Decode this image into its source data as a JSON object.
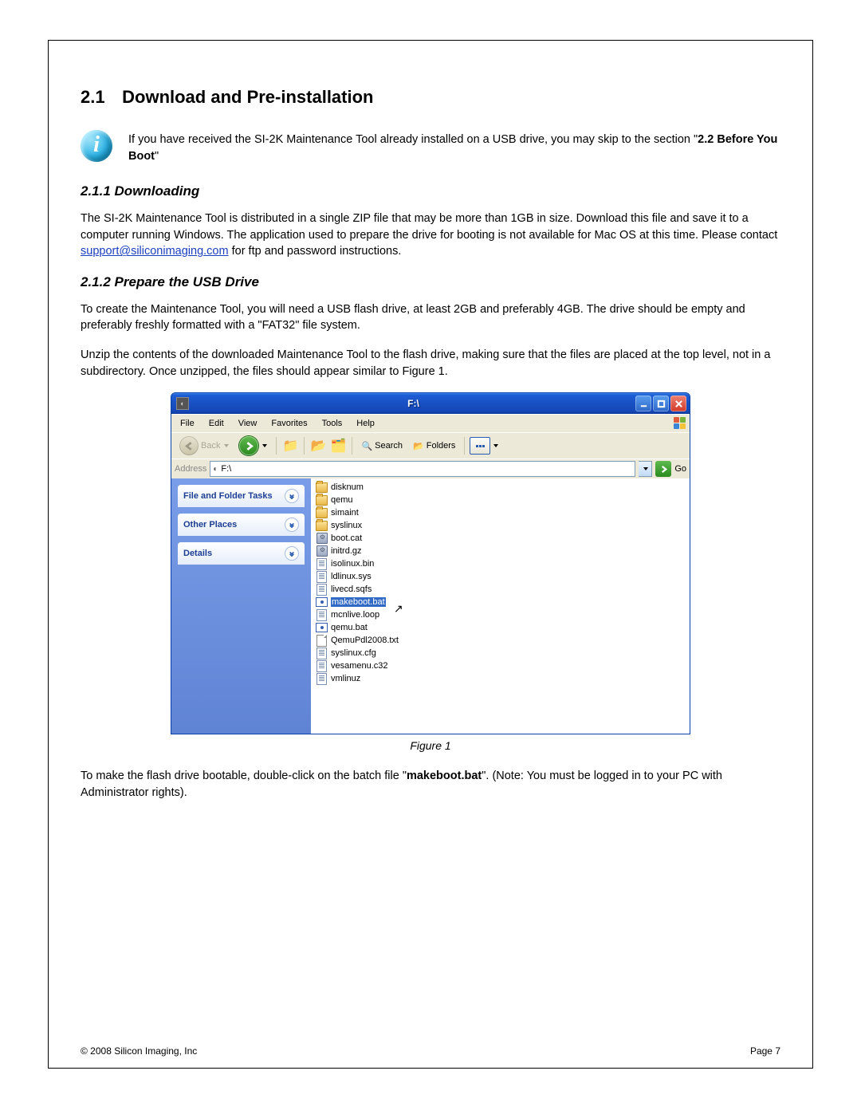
{
  "section": {
    "number": "2.1",
    "title": "Download and Pre-installation"
  },
  "info_note": {
    "pre": "If you have received the SI-2K Maintenance Tool already installed on a USB drive, you may skip to the section \"",
    "bold": "2.2 Before You Boot",
    "post": "\""
  },
  "sub1": {
    "heading": "2.1.1 Downloading",
    "para": "The SI-2K Maintenance Tool is distributed in a single ZIP file that may be more than 1GB in size.  Download this file and save it to a computer running Windows.  The application used to prepare the drive for booting is not available for Mac OS at this time.   Please contact ",
    "link": "support@siliconimaging.com",
    "para_after": " for ftp and password instructions."
  },
  "sub2": {
    "heading": "2.1.2 Prepare the USB Drive",
    "para1": "To create the Maintenance Tool, you will need a USB flash drive, at least 2GB and preferably 4GB.  The drive should be empty and preferably freshly formatted with a \"FAT32\" file system.",
    "para2": "Unzip the contents of the downloaded Maintenance Tool to the flash drive, making sure that the files are placed at the top level, not in a subdirectory.  Once unzipped, the files should appear similar to Figure 1."
  },
  "figure_caption": "Figure 1",
  "closing": {
    "pre": "To make the flash drive bootable, double-click on the batch file \"",
    "bold": "makeboot.bat",
    "post": "\".   (Note: You must be logged in to your PC with Administrator rights)."
  },
  "footer": {
    "copyright": "© 2008 Silicon Imaging, Inc",
    "page": "Page 7"
  },
  "explorer": {
    "title": "F:\\",
    "menu": [
      "File",
      "Edit",
      "View",
      "Favorites",
      "Tools",
      "Help"
    ],
    "toolbar": {
      "back": "Back",
      "search": "Search",
      "folders": "Folders"
    },
    "address": {
      "label": "Address",
      "value": "F:\\",
      "go": "Go"
    },
    "sidebar_panels": [
      "File and Folder Tasks",
      "Other Places",
      "Details"
    ],
    "files": [
      {
        "name": "disknum",
        "type": "folder"
      },
      {
        "name": "qemu",
        "type": "folder"
      },
      {
        "name": "simaint",
        "type": "folder"
      },
      {
        "name": "syslinux",
        "type": "folder"
      },
      {
        "name": "boot.cat",
        "type": "sys"
      },
      {
        "name": "initrd.gz",
        "type": "sys"
      },
      {
        "name": "isolinux.bin",
        "type": "file"
      },
      {
        "name": "ldlinux.sys",
        "type": "file"
      },
      {
        "name": "livecd.sqfs",
        "type": "file"
      },
      {
        "name": "makeboot.bat",
        "type": "bat",
        "selected": true
      },
      {
        "name": "mcnlive.loop",
        "type": "file"
      },
      {
        "name": "qemu.bat",
        "type": "bat"
      },
      {
        "name": "QemuPdl2008.txt",
        "type": "txt"
      },
      {
        "name": "syslinux.cfg",
        "type": "file"
      },
      {
        "name": "vesamenu.c32",
        "type": "file"
      },
      {
        "name": "vmlinuz",
        "type": "file"
      }
    ]
  }
}
